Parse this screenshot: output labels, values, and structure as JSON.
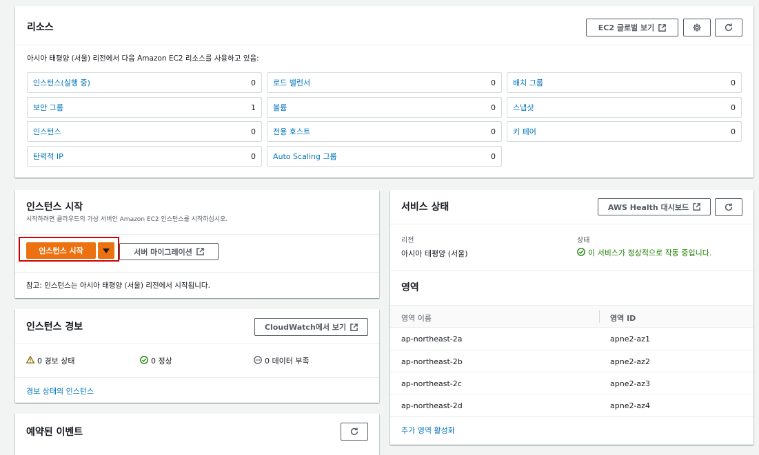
{
  "resources": {
    "title": "리소스",
    "global_view_button": "EC2 글로벌 보기",
    "description": "아시아 태평양 (서울) 리전에서 다음 Amazon EC2 리소스를 사용하고 있음:",
    "items": [
      {
        "label": "인스턴스(실행 중)",
        "count": "0"
      },
      {
        "label": "로드 밸런서",
        "count": "0"
      },
      {
        "label": "배치 그룹",
        "count": "0"
      },
      {
        "label": "보안 그룹",
        "count": "1"
      },
      {
        "label": "볼륨",
        "count": "0"
      },
      {
        "label": "스냅샷",
        "count": "0"
      },
      {
        "label": "인스턴스",
        "count": "0"
      },
      {
        "label": "전용 호스트",
        "count": "0"
      },
      {
        "label": "키 페어",
        "count": "0"
      },
      {
        "label": "탄력적 IP",
        "count": "0"
      },
      {
        "label": "Auto Scaling 그룹",
        "count": "0"
      }
    ]
  },
  "launch": {
    "title": "인스턴스 시작",
    "subtitle": "시작하려면 클라우드의 가상 서버인 Amazon EC2 인스턴스를 시작하십시오.",
    "launch_button": "인스턴스 시작",
    "migration_button": "서버 마이그레이션",
    "note": "참고: 인스턴스는 아시아 태평양 (서울) 리전에서 시작됩니다."
  },
  "alarms": {
    "title": "인스턴스 경보",
    "cloudwatch_button": "CloudWatch에서 보기",
    "alarm_state": "0 경보 상태",
    "ok_state": "0 정상",
    "insufficient": "0 데이터 부족",
    "link": "경보 상태의 인스턴스"
  },
  "events": {
    "title": "예약된 이벤트"
  },
  "service_health": {
    "title": "서비스 상태",
    "health_button": "AWS Health 대시보드",
    "region_label": "리전",
    "region_value": "아시아 태평양 (서울)",
    "status_label": "상태",
    "status_value": "이 서비스가 정상적으로 작동 중입니다."
  },
  "zones": {
    "title": "영역",
    "col_name": "영역 이름",
    "col_id": "영역 ID",
    "rows": [
      {
        "name": "ap-northeast-2a",
        "id": "apne2-az1"
      },
      {
        "name": "ap-northeast-2b",
        "id": "apne2-az2"
      },
      {
        "name": "ap-northeast-2c",
        "id": "apne2-az3"
      },
      {
        "name": "ap-northeast-2d",
        "id": "apne2-az4"
      }
    ],
    "enable_link": "추가 영역 활성화"
  },
  "colors": {
    "primary": "#ec7211",
    "link": "#0073bb",
    "success": "#1d8102",
    "warning": "#8a6d00",
    "highlight": "#d13212"
  }
}
